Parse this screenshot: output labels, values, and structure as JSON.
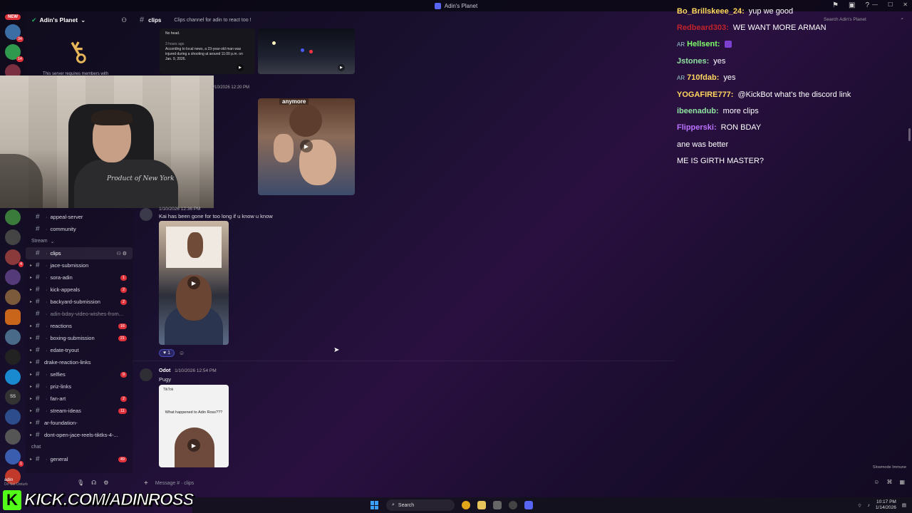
{
  "window": {
    "title": "Adin's Planet"
  },
  "server": {
    "name": "Adin's Planet",
    "key_note": "This server requires members with"
  },
  "rail": {
    "new_label": "NEW",
    "badges": [
      "34",
      "14",
      "10",
      "",
      "",
      "",
      "4",
      "",
      "",
      "",
      "",
      "",
      "",
      "",
      "",
      "",
      "",
      "",
      "",
      "1",
      "8",
      "8"
    ]
  },
  "channel_header": {
    "name": "clips",
    "topic": "Clips channel for adin to react too !",
    "search_placeholder": "Search Adin's Planet"
  },
  "sidebar": {
    "top_channels": [
      {
        "name": "appeal-server",
        "badge": ""
      },
      {
        "name": "community",
        "badge": ""
      }
    ],
    "category_stream": "Stream",
    "stream_channels": [
      {
        "name": "clips",
        "badge": "",
        "active": true
      },
      {
        "name": "jace-submission",
        "badge": ""
      },
      {
        "name": "sora-adin",
        "badge": "1"
      },
      {
        "name": "kick-appeals",
        "badge": "2"
      },
      {
        "name": "backyard-submission",
        "badge": "2"
      },
      {
        "name": "adin-bday-video-wishes-from...",
        "badge": ""
      },
      {
        "name": "reactions",
        "badge": "16"
      },
      {
        "name": "boxing-submission",
        "badge": "21"
      },
      {
        "name": "edate-tryout",
        "badge": ""
      },
      {
        "name": "drake-reaction-links",
        "badge": ""
      },
      {
        "name": "selfies",
        "badge": "9"
      },
      {
        "name": "priz-links",
        "badge": ""
      },
      {
        "name": "fan-art",
        "badge": "2"
      },
      {
        "name": "stream-ideas",
        "badge": "11"
      },
      {
        "name": "ar-foundation-",
        "badge": ""
      },
      {
        "name": "dont-open-jace-reels-tiktks-4-...",
        "badge": ""
      }
    ],
    "category_chat": "chat",
    "chat_channels": [
      {
        "name": "general",
        "badge": "49"
      }
    ]
  },
  "messages": {
    "news_card": {
      "line1": "No head.",
      "line2": "3 hours ago",
      "line3": "According to local news, a 23-year-old man was injured during a shooting at around 11:00 p.m. on Jan. 9, 2026."
    },
    "ts_1": "1/10/2026 12:20 PM",
    "tiktok1_caption": "anymore",
    "msg2_header": "1/10/2026 12:36 PM",
    "msg2_text": "Kai has been gone for too long if u know u know",
    "reaction_count": "1",
    "msg3_author": "Odot",
    "msg3_time": "1/10/2026 12:54 PM",
    "msg3_text": "Pugy",
    "tiktok3_caption": "What happened to Adin Ross???",
    "tiktok_label": "TikTok"
  },
  "composer": {
    "placeholder": "Message # · clips",
    "slowmode": "Slowmode Immune"
  },
  "user_panel": {
    "name": "adin",
    "status": "Do Not Disturb"
  },
  "kick_banner": {
    "text": "KICK.COM/ADINROSS",
    "letter": "K"
  },
  "taskbar": {
    "search": "Search",
    "time": "10:17 PM",
    "date": "1/14/2026"
  },
  "webcam": {
    "shirt_text": "Product of New York"
  },
  "chat": [
    {
      "user": "Bo_Brillskeee_24:",
      "color": "#ffd75e",
      "text": "yup we good",
      "icon": ""
    },
    {
      "user": "Redbeard303:",
      "color": "#c0232b",
      "text": "WE WANT MORE ARMAN",
      "icon": ""
    },
    {
      "user": "Hellsent:",
      "color": "#7fff6a",
      "text": "",
      "icon": "AR",
      "emote": true
    },
    {
      "user": "Jstones:",
      "color": "#8fe3a0",
      "text": "yes",
      "icon": ""
    },
    {
      "user": "710fdab:",
      "color": "#ffd75e",
      "text": "yes",
      "icon": "AR"
    },
    {
      "user": "YOGAFIRE777:",
      "color": "#ffd75e",
      "text": "@KickBot what's the discord link",
      "icon": ""
    },
    {
      "user": "ibeenadub:",
      "color": "#8fe3a0",
      "text": "more clips",
      "icon": ""
    },
    {
      "user": "Flipperski:",
      "color": "#b972ff",
      "text": "RON BDAY",
      "icon": ""
    },
    {
      "user": "",
      "color": "#ffffff",
      "text": "ane was better",
      "icon": ""
    },
    {
      "user": "",
      "color": "#ffffff",
      "text": "ME IS GIRTH MASTER?",
      "icon": ""
    }
  ]
}
